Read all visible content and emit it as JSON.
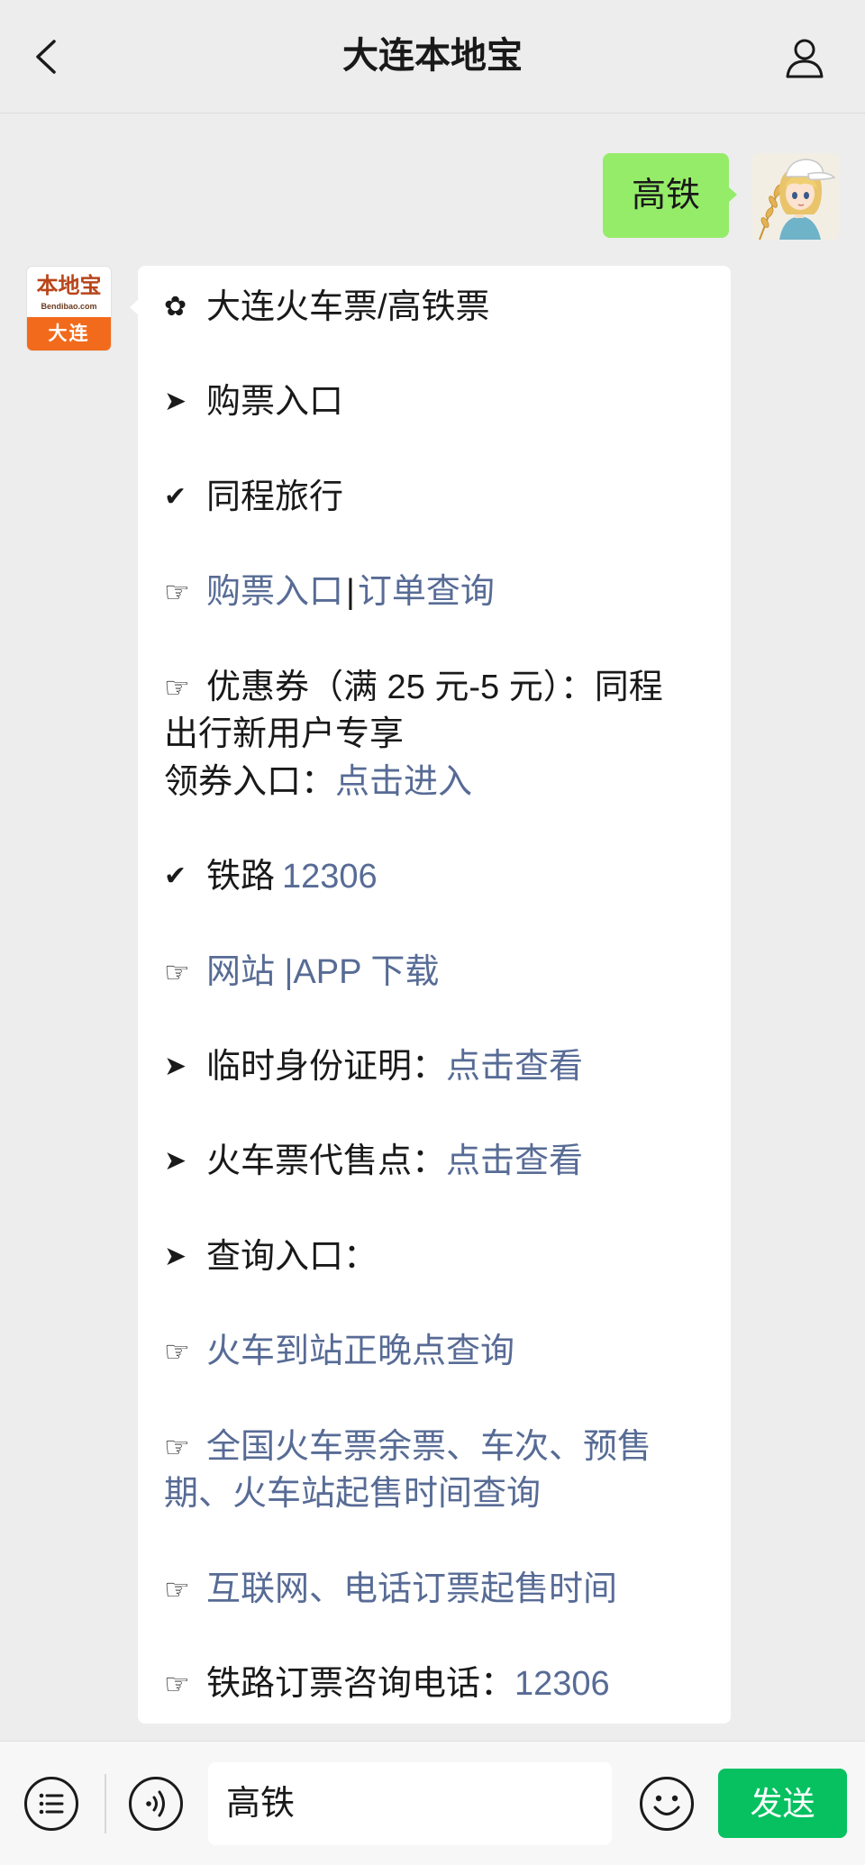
{
  "header": {
    "title": "大连本地宝",
    "back_icon": "chevron-left-icon",
    "profile_icon": "user-profile-icon"
  },
  "colors": {
    "background": "#ededed",
    "user_bubble": "#95ec69",
    "bot_bubble": "#ffffff",
    "link": "#576b95",
    "text": "#191919",
    "send_button": "#07c160",
    "brand_orange": "#f26a1b"
  },
  "user_message": {
    "text": "高铁",
    "avatar_icon": "anime-avatar-icon"
  },
  "bot_message": {
    "avatar": {
      "brand": "本地宝",
      "site": "Bendibao.com",
      "city": "大连"
    },
    "paragraphs": [
      {
        "lines": [
          {
            "marker": "✿",
            "parts": [
              {
                "text": "大连火车票/高铁票",
                "link": false
              }
            ]
          }
        ]
      },
      {
        "lines": [
          {
            "marker": "➤",
            "parts": [
              {
                "text": "购票入口",
                "link": false
              }
            ]
          }
        ]
      },
      {
        "lines": [
          {
            "marker": "✔",
            "parts": [
              {
                "text": "同程旅行",
                "link": false
              }
            ]
          }
        ]
      },
      {
        "lines": [
          {
            "marker": "☞",
            "parts": [
              {
                "text": "购票入口",
                "link": true
              },
              {
                "text": "|",
                "link": false
              },
              {
                "text": "订单查询",
                "link": true
              }
            ]
          }
        ]
      },
      {
        "lines": [
          {
            "marker": "☞",
            "parts": [
              {
                "text": "优惠券（满 25 元-5 元）：同程",
                "link": false
              }
            ]
          },
          {
            "parts": [
              {
                "text": "出行新用户专享",
                "link": false
              }
            ]
          },
          {
            "parts": [
              {
                "text": "领券入口：",
                "link": false
              },
              {
                "text": "点击进入",
                "link": true
              }
            ]
          }
        ]
      },
      {
        "lines": [
          {
            "marker": "✔",
            "parts": [
              {
                "text": "铁路",
                "link": false
              },
              {
                "text": "12306",
                "link": true
              }
            ]
          }
        ]
      },
      {
        "lines": [
          {
            "marker": "☞",
            "parts": [
              {
                "text": "网站 |APP 下载",
                "link": true
              }
            ]
          }
        ]
      },
      {
        "lines": [
          {
            "marker": "➤",
            "parts": [
              {
                "text": "临时身份证明：",
                "link": false
              },
              {
                "text": "点击查看",
                "link": true
              }
            ]
          }
        ]
      },
      {
        "lines": [
          {
            "marker": "➤",
            "parts": [
              {
                "text": "火车票代售点：",
                "link": false
              },
              {
                "text": "点击查看",
                "link": true
              }
            ]
          }
        ]
      },
      {
        "lines": [
          {
            "marker": "➤",
            "parts": [
              {
                "text": "查询入口：",
                "link": false
              }
            ]
          }
        ]
      },
      {
        "lines": [
          {
            "marker": "☞",
            "parts": [
              {
                "text": "火车到站正晚点查询",
                "link": true
              }
            ]
          }
        ]
      },
      {
        "lines": [
          {
            "marker": "☞",
            "parts": [
              {
                "text": "全国火车票余票、车次、预售",
                "link": true
              }
            ]
          },
          {
            "parts": [
              {
                "text": "期、火车站起售时间查询",
                "link": true
              }
            ]
          }
        ]
      },
      {
        "lines": [
          {
            "marker": "☞",
            "parts": [
              {
                "text": "互联网、电话订票起售时间",
                "link": true
              }
            ]
          }
        ]
      },
      {
        "lines": [
          {
            "marker": "☞",
            "parts": [
              {
                "text": "铁路订票咨询电话：",
                "link": false
              },
              {
                "text": "12306",
                "link": true
              }
            ]
          }
        ]
      }
    ]
  },
  "input_bar": {
    "menu_icon": "menu-list-icon",
    "voice_icon": "voice-icon",
    "input_value": "高铁",
    "emoji_icon": "emoji-icon",
    "send_label": "发送"
  }
}
